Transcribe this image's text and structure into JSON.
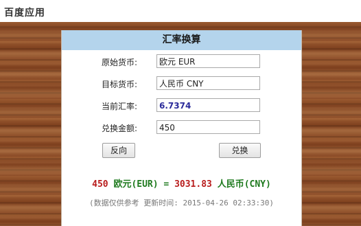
{
  "app": {
    "title": "百度应用"
  },
  "converter": {
    "title": "汇率换算",
    "source_label": "原始货币:",
    "source_value": "欧元 EUR",
    "target_label": "目标货币:",
    "target_value": "人民币 CNY",
    "rate_label": "当前汇率:",
    "rate_value": "6.7374",
    "amount_label": "兑换金额:",
    "amount_value": "450",
    "reverse_button": "反向",
    "convert_button": "兑换"
  },
  "result": {
    "from_amount": "450",
    "from_currency": "欧元(EUR)",
    "equals": "=",
    "to_amount": "3031.83",
    "to_currency": "人民币(CNY)"
  },
  "note": "(数据仅供参考 更新时间: 2015-04-26 02:33:30)",
  "colors": {
    "header_bg": "#b4d4ec",
    "result_red": "#b81c1c",
    "result_green": "#1e7a1e",
    "rate_text": "#2a2a9a"
  }
}
